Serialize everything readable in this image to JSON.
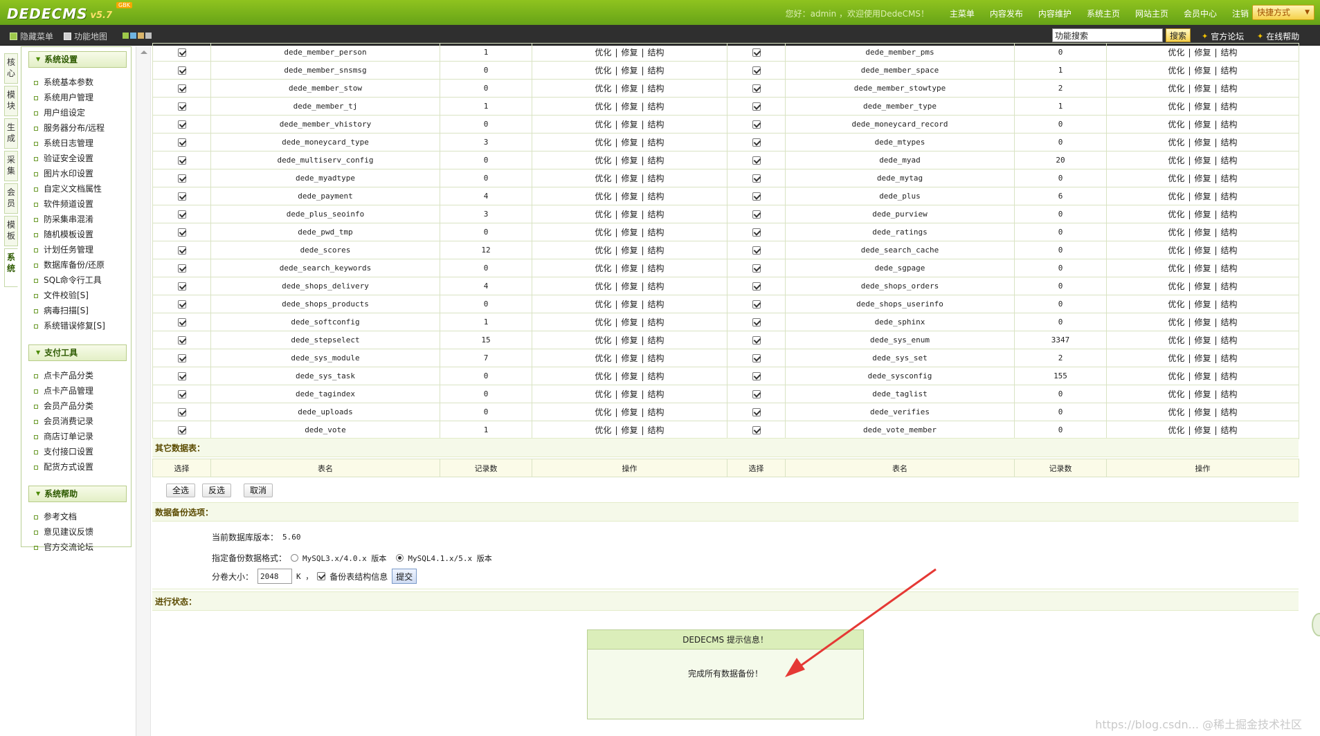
{
  "header": {
    "logo_text": "DEDECMS",
    "logo_version": "v5.7",
    "logo_badge": "GBK",
    "greeting": "您好：admin ，欢迎使用DedeCMS！",
    "nav": [
      "主菜单",
      "内容发布",
      "内容维护",
      "系统主页",
      "网站主页",
      "会员中心",
      "注销"
    ],
    "quick_menu": "快捷方式"
  },
  "subbar": {
    "hide_menu": "隐藏菜单",
    "site_map": "功能地图",
    "swatch_colors": [
      "#9ec94a",
      "#6fb3e0",
      "#d9b46a",
      "#bfbfbf"
    ],
    "search_placeholder": "功能搜索",
    "search_value": "功能搜索",
    "search_button": "搜索",
    "forum_link": "官方论坛",
    "help_link": "在线帮助"
  },
  "vtabs": [
    "核心",
    "模块",
    "生成",
    "采集",
    "会员",
    "模板",
    "系统"
  ],
  "sidebar": {
    "groups": [
      {
        "title": "系统设置",
        "items": [
          "系统基本参数",
          "系统用户管理",
          "用户组设定",
          "服务器分布/远程",
          "系统日志管理",
          "验证安全设置",
          "图片水印设置",
          "自定义文档属性",
          "软件频道设置",
          "防采集串混淆",
          "随机模板设置",
          "计划任务管理",
          "数据库备份/还原",
          "SQL命令行工具",
          "文件校验[S]",
          "病毒扫描[S]",
          "系统错误修复[S]"
        ]
      },
      {
        "title": "支付工具",
        "items": [
          "点卡产品分类",
          "点卡产品管理",
          "会员产品分类",
          "会员消费记录",
          "商店订单记录",
          "支付接口设置",
          "配货方式设置"
        ]
      },
      {
        "title": "系统帮助",
        "items": [
          "参考文档",
          "意见建议反馈",
          "官方交流论坛"
        ]
      }
    ]
  },
  "ops": {
    "opt": "优化",
    "repair": "修复",
    "struct": "结构",
    "sep": "|"
  },
  "rows": [
    [
      {
        "name": "dede_member_person",
        "count": "1"
      },
      {
        "name": "dede_member_pms",
        "count": "0"
      }
    ],
    [
      {
        "name": "dede_member_snsmsg",
        "count": "0"
      },
      {
        "name": "dede_member_space",
        "count": "1"
      }
    ],
    [
      {
        "name": "dede_member_stow",
        "count": "0"
      },
      {
        "name": "dede_member_stowtype",
        "count": "2"
      }
    ],
    [
      {
        "name": "dede_member_tj",
        "count": "1"
      },
      {
        "name": "dede_member_type",
        "count": "1"
      }
    ],
    [
      {
        "name": "dede_member_vhistory",
        "count": "0"
      },
      {
        "name": "dede_moneycard_record",
        "count": "0"
      }
    ],
    [
      {
        "name": "dede_moneycard_type",
        "count": "3"
      },
      {
        "name": "dede_mtypes",
        "count": "0"
      }
    ],
    [
      {
        "name": "dede_multiserv_config",
        "count": "0"
      },
      {
        "name": "dede_myad",
        "count": "20"
      }
    ],
    [
      {
        "name": "dede_myadtype",
        "count": "0"
      },
      {
        "name": "dede_mytag",
        "count": "0"
      }
    ],
    [
      {
        "name": "dede_payment",
        "count": "4"
      },
      {
        "name": "dede_plus",
        "count": "6"
      }
    ],
    [
      {
        "name": "dede_plus_seoinfo",
        "count": "3"
      },
      {
        "name": "dede_purview",
        "count": "0"
      }
    ],
    [
      {
        "name": "dede_pwd_tmp",
        "count": "0"
      },
      {
        "name": "dede_ratings",
        "count": "0"
      }
    ],
    [
      {
        "name": "dede_scores",
        "count": "12"
      },
      {
        "name": "dede_search_cache",
        "count": "0"
      }
    ],
    [
      {
        "name": "dede_search_keywords",
        "count": "0"
      },
      {
        "name": "dede_sgpage",
        "count": "0"
      }
    ],
    [
      {
        "name": "dede_shops_delivery",
        "count": "4"
      },
      {
        "name": "dede_shops_orders",
        "count": "0"
      }
    ],
    [
      {
        "name": "dede_shops_products",
        "count": "0"
      },
      {
        "name": "dede_shops_userinfo",
        "count": "0"
      }
    ],
    [
      {
        "name": "dede_softconfig",
        "count": "1"
      },
      {
        "name": "dede_sphinx",
        "count": "0"
      }
    ],
    [
      {
        "name": "dede_stepselect",
        "count": "15"
      },
      {
        "name": "dede_sys_enum",
        "count": "3347"
      }
    ],
    [
      {
        "name": "dede_sys_module",
        "count": "7"
      },
      {
        "name": "dede_sys_set",
        "count": "2"
      }
    ],
    [
      {
        "name": "dede_sys_task",
        "count": "0"
      },
      {
        "name": "dede_sysconfig",
        "count": "155"
      }
    ],
    [
      {
        "name": "dede_tagindex",
        "count": "0"
      },
      {
        "name": "dede_taglist",
        "count": "0"
      }
    ],
    [
      {
        "name": "dede_uploads",
        "count": "0"
      },
      {
        "name": "dede_verifies",
        "count": "0"
      }
    ],
    [
      {
        "name": "dede_vote",
        "count": "1"
      },
      {
        "name": "dede_vote_member",
        "count": "0"
      }
    ]
  ],
  "other_tables": {
    "title": "其它数据表：",
    "headers": [
      "选择",
      "表名",
      "记录数",
      "操作",
      "选择",
      "表名",
      "记录数",
      "操作"
    ],
    "buttons": [
      "全选",
      "反选",
      "取消"
    ]
  },
  "backup": {
    "title": "数据备份选项：",
    "version_label": "当前数据库版本：",
    "version_value": "5.60",
    "format_label": "指定备份数据格式：",
    "format_opt1": "MySQL3.x/4.0.x 版本",
    "format_opt2": "MySQL4.1.x/5.x 版本",
    "size_label": "分卷大小：",
    "size_value": "2048",
    "size_unit": "K ，",
    "struct_label": "备份表结构信息",
    "submit": "提交"
  },
  "progress": {
    "title": "进行状态：",
    "msg_title": "DEDECMS 提示信息！",
    "msg_body": "完成所有数据备份！"
  },
  "watermark": "https://blog.csdn... @稀土掘金技术社区",
  "colors": {
    "header_green": "#79b31b",
    "accent_red": "#e53935",
    "msg_title_bg": "#dbeeba"
  }
}
